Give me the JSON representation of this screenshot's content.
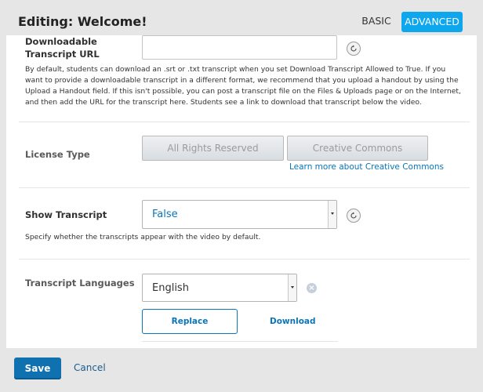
{
  "header": {
    "title": "Editing: Welcome!",
    "mode_basic": "BASIC",
    "mode_advanced": "ADVANCED"
  },
  "downloadable_transcript": {
    "label": "Downloadable Transcript URL",
    "value": "",
    "help": "By default, students can download an .srt or .txt transcript when you set Download Transcript Allowed to True. If you want to provide a downloadable transcript in a different format, we recommend that you upload a handout by using the Upload a Handout field. If this isn't possible, you can post a transcript file on the Files & Uploads page or on the Internet, and then add the URL for the transcript here. Students see a link to download that transcript below the video."
  },
  "license_type": {
    "label": "License Type",
    "option_all_rights": "All Rights Reserved",
    "option_cc": "Creative Commons",
    "learn_more": "Learn more about Creative Commons"
  },
  "show_transcript": {
    "label": "Show Transcript",
    "selected": "False",
    "help": "Specify whether the transcripts appear with the video by default."
  },
  "transcript_languages": {
    "label": "Transcript Languages",
    "selected": "English",
    "replace_label": "Replace",
    "download_label": "Download"
  },
  "footer": {
    "save_label": "Save",
    "cancel_label": "Cancel"
  },
  "colors": {
    "accent": "#0ea6ec",
    "link": "#0a75b8",
    "primary_button": "#1071b1"
  }
}
